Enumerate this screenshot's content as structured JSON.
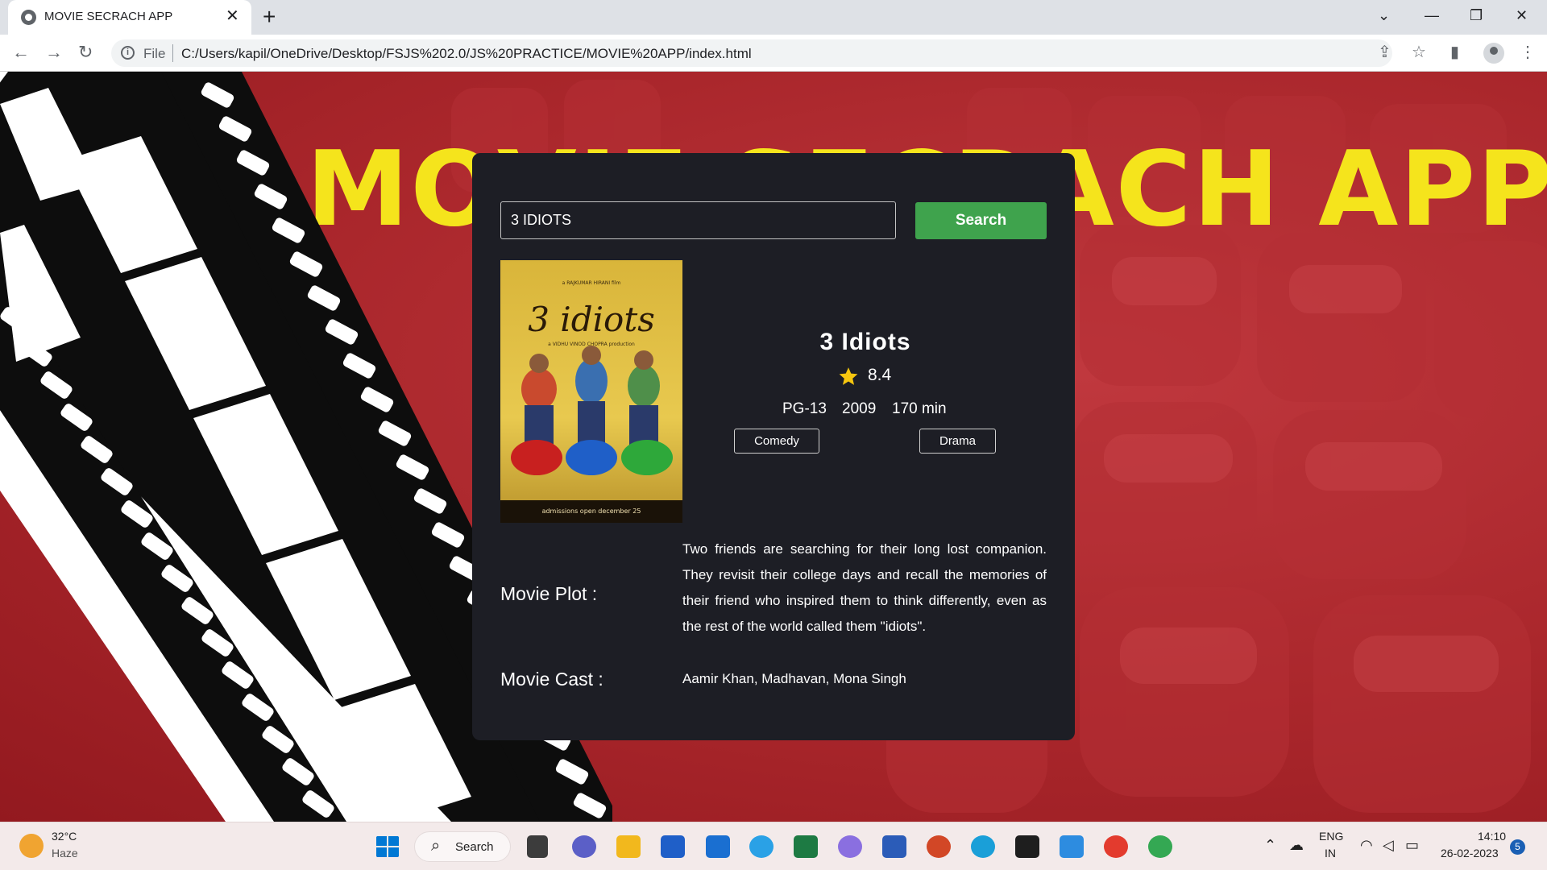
{
  "browser": {
    "tab_title": "MOVIE SECRACH APP",
    "scheme_label": "File",
    "url": "C:/Users/kapil/OneDrive/Desktop/FSJS%202.0/JS%20PRACTICE/MOVIE%20APP/index.html"
  },
  "page": {
    "hero_title": "MOVIE SECRACH APP"
  },
  "search": {
    "value": "3 IDIOTS",
    "button_label": "Search"
  },
  "poster": {
    "credit_top": "a RAJKUMAR HIRANI film",
    "title": "3 idiots",
    "credit_mid": "a VIDHU VINOD CHOPRA production",
    "footer": "admissions open december 25"
  },
  "movie": {
    "title": "3 Idiots",
    "rating": "8.4",
    "rated": "PG-13",
    "year": "2009",
    "runtime": "170 min",
    "genres": [
      "Comedy",
      "Drama"
    ],
    "plot_label": "Movie Plot :",
    "plot": "Two friends are searching for their long lost companion. They revisit their college days and recall the memories of their friend who inspired them to think differently, even as the rest of the world called them \"idiots\".",
    "cast_label": "Movie Cast :",
    "cast": "Aamir Khan, Madhavan, Mona Singh"
  },
  "taskbar": {
    "temperature": "32°C",
    "weather": "Haze",
    "search_label": "Search",
    "lang_top": "ENG",
    "lang_bottom": "IN",
    "time": "14:10",
    "date": "26-02-2023",
    "notifications": "5"
  },
  "colors": {
    "background_red": "#a9262b",
    "title_yellow": "#f5e41c",
    "card_bg": "#1d1e25",
    "search_button": "#3fa34d"
  }
}
